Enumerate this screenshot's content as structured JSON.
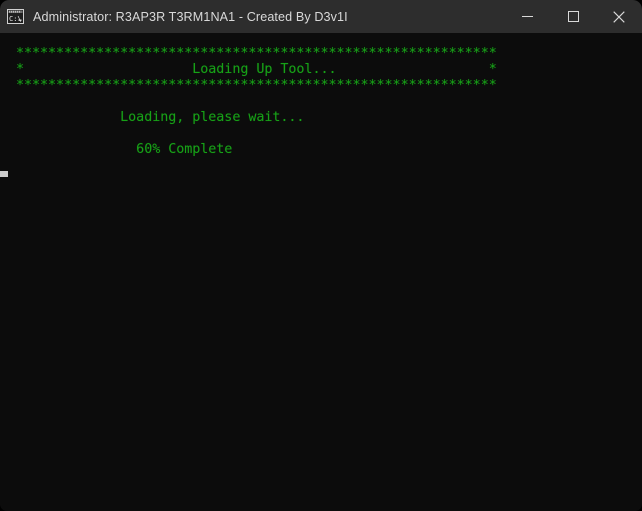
{
  "window": {
    "title": "Administrator:  R3AP3R T3RM1NA1 - Created By D3v1I",
    "icon_name": "cmd-prompt-icon",
    "titlebar_color": "#2d2d2d",
    "background_color": "#0c0c0c"
  },
  "caption_buttons": {
    "minimize_label": "Minimize",
    "maximize_label": "Maximize",
    "close_label": "Close"
  },
  "console": {
    "text_color": "#17a117",
    "border_char": "*",
    "border_width": 60,
    "banner_title": "Loading Up Tool...",
    "status_line": "Loading, please wait...",
    "progress_line": "60% Complete",
    "progress_percent": 60,
    "lines": [
      "************************************************************",
      "*                     Loading Up Tool...                   *",
      "************************************************************",
      "",
      "             Loading, please wait...",
      "",
      "               60% Complete"
    ],
    "body": "************************************************************\n*                     Loading Up Tool...                   *\n************************************************************\n\n             Loading, please wait...\n\n               60% Complete"
  }
}
